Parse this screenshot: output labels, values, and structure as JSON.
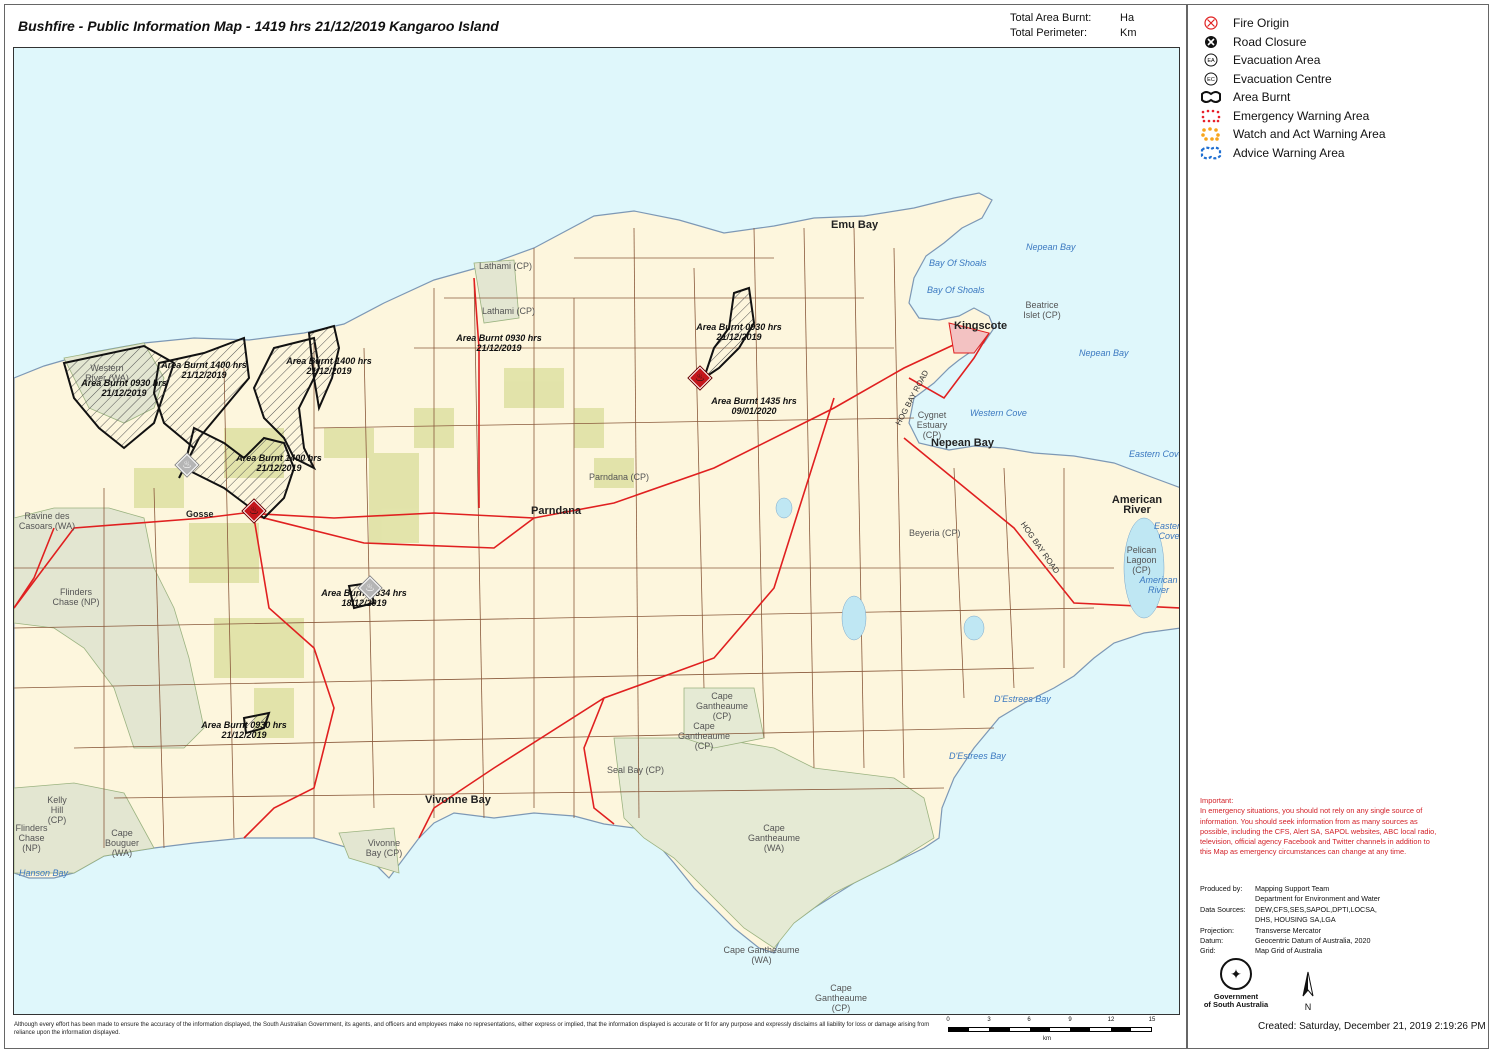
{
  "title": "Bushfire - Public Information Map - 1419 hrs 21/12/2019 Kangaroo Island",
  "stats": {
    "area_label": "Total Area Burnt:",
    "area_unit": "Ha",
    "perimeter_label": "Total Perimeter:",
    "perimeter_unit": "Km"
  },
  "legend": {
    "items": [
      {
        "label": "Fire Origin",
        "icon": "fire-origin-icon"
      },
      {
        "label": "Road Closure",
        "icon": "road-closure-icon"
      },
      {
        "label": "Evacuation Area",
        "icon": "evacuation-area-icon",
        "badge": "EA"
      },
      {
        "label": "Evacuation Centre",
        "icon": "evacuation-centre-icon",
        "badge": "EC"
      },
      {
        "label": "Area Burnt",
        "icon": "area-burnt-icon"
      },
      {
        "label": "Emergency Warning Area",
        "icon": "emergency-warning-icon",
        "color": "#e8202a"
      },
      {
        "label": "Watch and Act Warning Area",
        "icon": "watch-act-icon",
        "color": "#f7a51c"
      },
      {
        "label": "Advice Warning Area",
        "icon": "advice-warning-icon",
        "color": "#1f6fd1"
      }
    ]
  },
  "map": {
    "towns": {
      "emu_bay": "Emu Bay",
      "kingscote": "Kingscote",
      "nepean_bay_town": "Nepean Bay",
      "american_river": "American River",
      "parndana": "Parndana",
      "gosse": "Gosse",
      "vivonne_bay": "Vivonne Bay"
    },
    "water": {
      "nepean_bay_1": "Nepean Bay",
      "bay_of_shoals_1": "Bay Of Shoals",
      "bay_of_shoals_2": "Bay Of Shoals",
      "nepean_bay_2": "Nepean Bay",
      "western_cove": "Western Cove",
      "eastern_cove": "Eastern Cove",
      "eastern_cove_2": "Eastern Cove",
      "american_river_water": "American River",
      "destrees_bay_1": "D'Estrees Bay",
      "destrees_bay_2": "D'Estrees Bay",
      "hanson_bay": "Hanson Bay"
    },
    "parks": {
      "lathami_1": "Lathami (CP)",
      "lathami_2": "Lathami (CP)",
      "western_river": "Western River (WA)",
      "ravine": "Ravine des Casoars (WA)",
      "flinders_chase": "Flinders Chase (NP)",
      "parndana_cp": "Parndana (CP)",
      "beatrice": "Beatrice Islet (CP)",
      "cygnet": "Cygnet Estuary (CP)",
      "beyeria": "Beyeria (CP)",
      "pelican": "Pelican Lagoon (CP)",
      "gantheaume_cp_1": "Cape Gantheaume (CP)",
      "gantheaume_cp_2": "Cape Gantheaume (CP)",
      "seal_bay": "Seal Bay (CP)",
      "gantheaume_wa": "Cape Gantheaume (WA)",
      "gantheaume_wa_2": "Cape Gantheaume (WA)",
      "gantheaume_cp_3": "Cape Gantheaume (CP)",
      "kelly_hill": "Kelly Hill (CP)",
      "flinders_chase_2": "Flinders Chase (NP)",
      "cape_bouguer": "Cape Bouguer (WA)",
      "vivonne_cp": "Vivonne Bay (CP)"
    },
    "roads": {
      "hog_bay_1": "HOG BAY ROAD",
      "hog_bay_2": "HOG BAY ROAD"
    },
    "burnt": {
      "b1": "Area Burnt 0930 hrs 21/12/2019",
      "b2": "Area Burnt 1400 hrs 21/12/2019",
      "b3": "Area Burnt 0930 hrs 21/12/2019",
      "b4": "Area Burnt 1400 hrs 21/12/2019",
      "b5": "Area Burnt 1400 hrs 21/12/2019",
      "b6": "Area Burnt 0930 hrs 21/12/2019",
      "b7": "Area Burnt 1435 hrs 09/01/2020",
      "b8": "Area Burnt 1334 hrs 18/12/2019",
      "b9": "Area Burnt 0930 hrs 21/12/2019"
    }
  },
  "important": "Important:\nIn emergency situations, you should not rely on any single source of information. You should seek information from as many sources as possible, including the CFS, Alert SA, SAPOL websites, ABC local radio, television, official agency Facebook and Twitter channels in addition to this Map as emergency circumstances can change at any time.",
  "meta": {
    "produced_by_k": "Produced by:",
    "produced_by_v": "Mapping Support Team\nDepartment for Environment and Water",
    "sources_k": "Data Sources:",
    "sources_v": "DEW,CFS,SES,SAPOL,DPTI,LOCSA,\nDHS, HOUSING SA,LGA",
    "projection_k": "Projection:",
    "projection_v": "Transverse Mercator",
    "datum_k": "Datum:",
    "datum_v": "Geocentric Datum of Australia, 2020",
    "grid_k": "Grid:",
    "grid_v": "Map Grid of Australia"
  },
  "logo": "Government\nof South Australia",
  "north": "N",
  "scale": {
    "ticks": [
      "0",
      "3",
      "6",
      "9",
      "12",
      "15"
    ],
    "unit": "km"
  },
  "disclaimer": "Although every effort has been made to ensure the accuracy of the information displayed, the South Australian Government, its agents, and officers and employees make no representations, either express or implied, that the information displayed is accurate or fit for any purpose and expressly disclaims all liability for loss or damage arising from reliance upon the information displayed.",
  "created": "Created: Saturday, December 21, 2019 2:19:26 PM"
}
